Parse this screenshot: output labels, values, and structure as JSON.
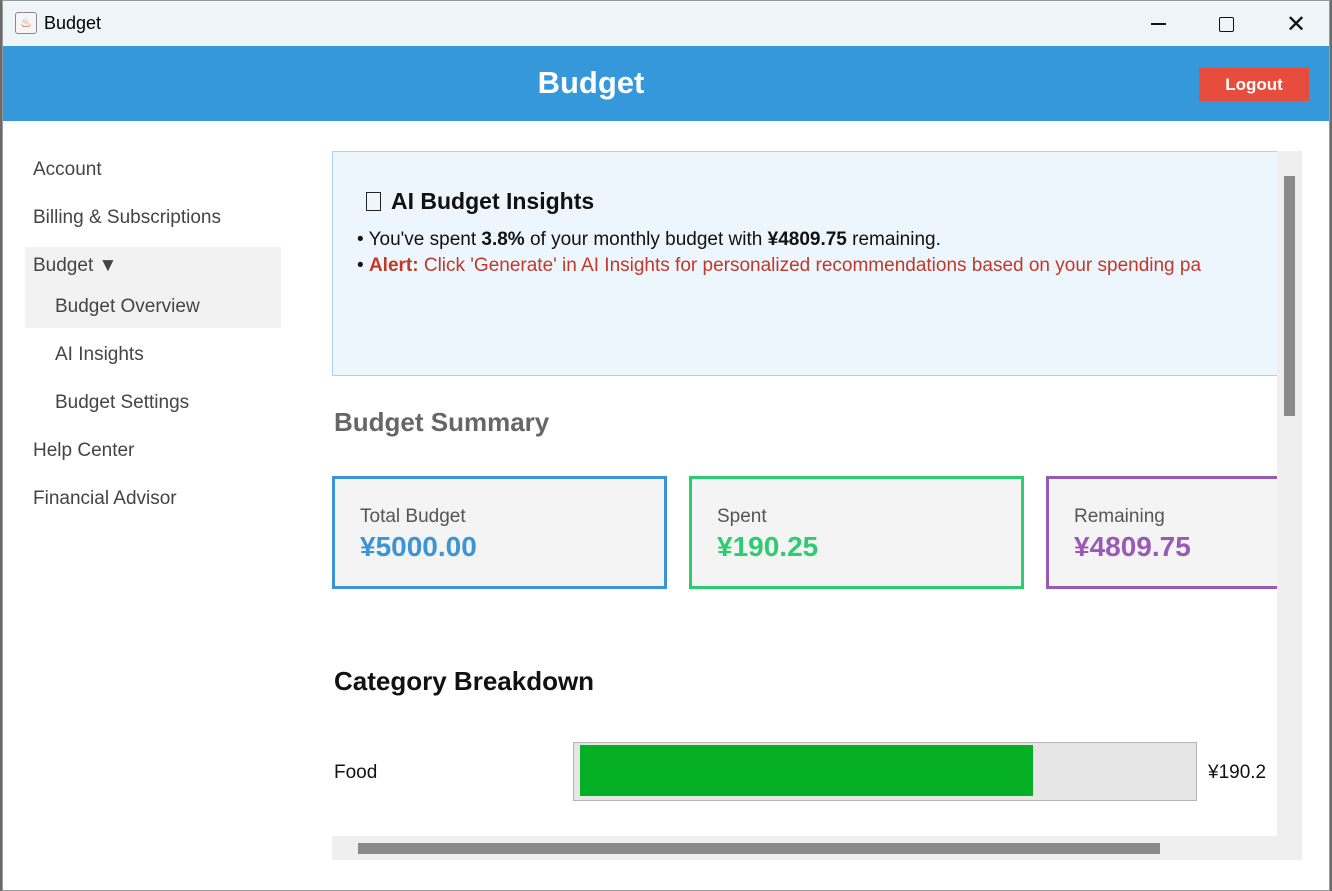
{
  "window": {
    "title": "Budget",
    "icon": "java-cup-icon"
  },
  "header": {
    "title": "Budget",
    "logout_label": "Logout"
  },
  "sidebar": {
    "items": [
      {
        "label": "Account"
      },
      {
        "label": "Billing & Subscriptions"
      },
      {
        "label": "Budget ▼"
      },
      {
        "label": "Budget Overview"
      },
      {
        "label": "AI Insights"
      },
      {
        "label": "Budget Settings"
      },
      {
        "label": "Help Center"
      },
      {
        "label": "Financial Advisor"
      }
    ]
  },
  "insights": {
    "icon": "lightbulb-icon",
    "title": "AI Budget Insights",
    "line1": {
      "bullet": "• ",
      "pre": "You've spent ",
      "percent": "3.8%",
      "mid": " of your monthly budget with ",
      "remaining": "¥4809.75",
      "post": " remaining."
    },
    "line2": {
      "bullet": "• ",
      "label": "Alert:",
      "text": " Click 'Generate' in AI Insights for personalized recommendations based on your spending pa"
    }
  },
  "summary": {
    "title": "Budget Summary",
    "cards": [
      {
        "label": "Total Budget",
        "value": "¥5000.00",
        "color": "#3a94d6"
      },
      {
        "label": "Spent",
        "value": "¥190.25",
        "color": "#2ecc71"
      },
      {
        "label": "Remaining",
        "value": "¥4809.75",
        "color": "#9b59b6"
      }
    ]
  },
  "categories": {
    "title": "Category Breakdown",
    "items": [
      {
        "name": "Food",
        "amount": "¥190.2",
        "fill_fraction": 0.74,
        "color": "#06b025"
      }
    ]
  },
  "colors": {
    "header": "#3498db",
    "logout": "#e74c3c",
    "alert": "#c0392b"
  }
}
